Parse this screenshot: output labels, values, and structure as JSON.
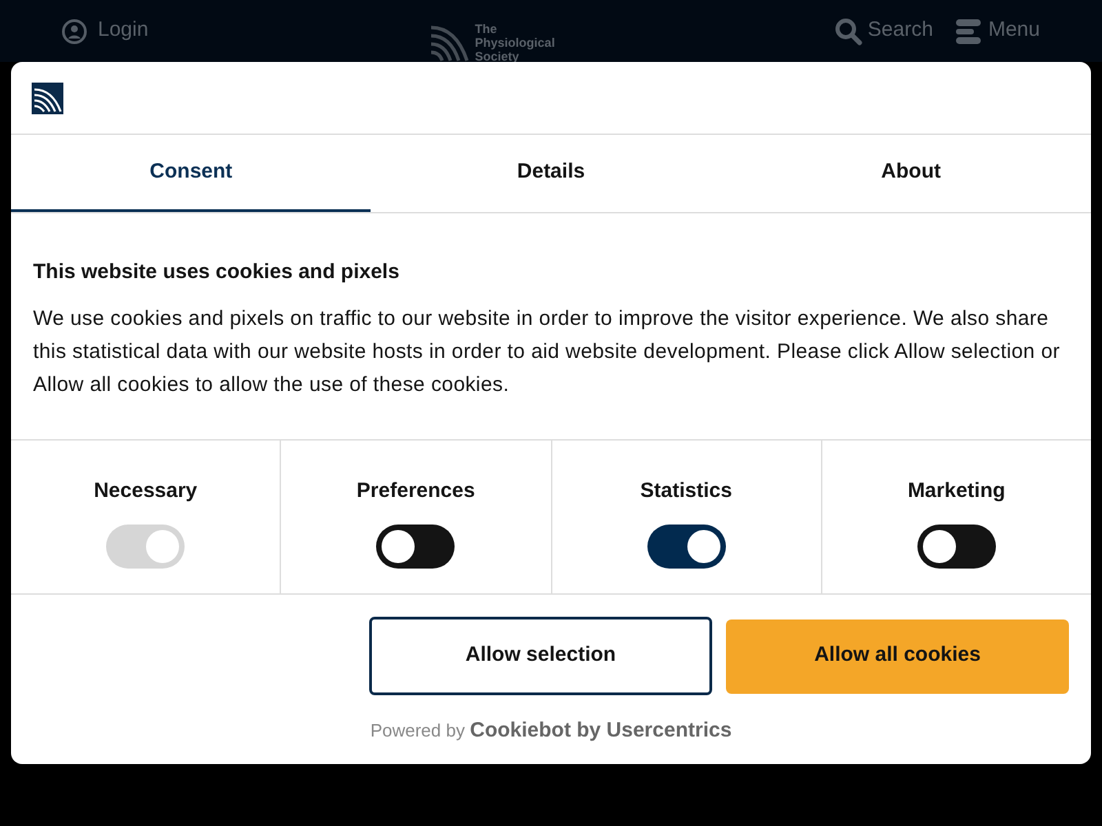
{
  "site_header": {
    "login": "Login",
    "logo_lines": [
      "The",
      "Physiological",
      "Society"
    ],
    "search": "Search",
    "menu": "Menu"
  },
  "dialog": {
    "tabs": [
      {
        "label": "Consent",
        "selected": true
      },
      {
        "label": "Details",
        "selected": false
      },
      {
        "label": "About",
        "selected": false
      }
    ],
    "heading": "This website uses cookies and pixels",
    "body": "We use cookies and pixels on traffic to our website in order to improve the visitor experience. We also share this statistical data with our website hosts in order to aid website development. Please click Allow selection or Allow all cookies to allow the use of these cookies.",
    "categories": [
      {
        "label": "Necessary",
        "checked": true,
        "disabled": true
      },
      {
        "label": "Preferences",
        "checked": false,
        "disabled": false
      },
      {
        "label": "Statistics",
        "checked": true,
        "disabled": false
      },
      {
        "label": "Marketing",
        "checked": false,
        "disabled": false
      }
    ],
    "buttons": [
      {
        "label": "Allow selection",
        "kind": "outline"
      },
      {
        "label": "Allow all cookies",
        "kind": "primary"
      }
    ],
    "powered_by": "Powered by",
    "brand": "Cookiebot by Usercentrics"
  }
}
